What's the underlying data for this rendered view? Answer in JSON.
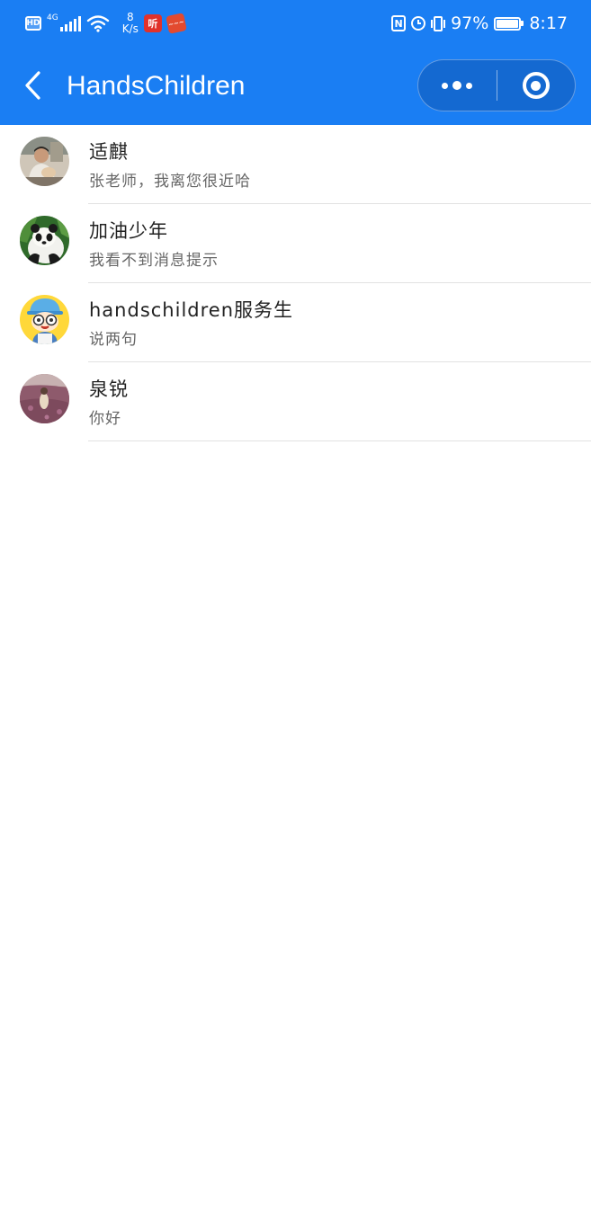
{
  "status_bar": {
    "left_badge": "HD",
    "network_type": "4G",
    "speed_value": "8",
    "speed_unit": "K/s",
    "app_icon_1": "听",
    "app_icon_2": "~~~",
    "nfc_label": "N",
    "battery_percent": "97%",
    "time": "8:17",
    "battery_level": 0.97
  },
  "header": {
    "title": "HandsChildren",
    "background_color": "#1a7ef3"
  },
  "chats": [
    {
      "name": "适麒",
      "preview": "张老师，我离您很近哈",
      "avatar": "man-avatar"
    },
    {
      "name": "加油少年",
      "preview": "我看不到消息提示",
      "avatar": "panda-avatar"
    },
    {
      "name": "handschildren服务生",
      "preview": "说两句",
      "avatar": "cartoon-boy-avatar"
    },
    {
      "name": "泉锐",
      "preview": "你好",
      "avatar": "flower-field-avatar"
    }
  ]
}
